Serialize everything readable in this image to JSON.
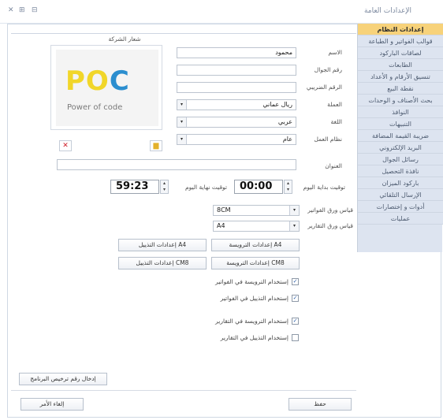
{
  "window": {
    "title": "الإعدادات العامة",
    "controls": [
      "⊟",
      "⊞",
      "⊠"
    ]
  },
  "sidebar": {
    "items": [
      {
        "label": "إعدادات النظام",
        "active": true
      },
      {
        "label": "قوالب الفواتير و الطباعة"
      },
      {
        "label": "لصاقات الباركود"
      },
      {
        "label": "الطابعات"
      },
      {
        "label": "تنسيق الأرقام و الأعداد"
      },
      {
        "label": "نقطة البيع"
      },
      {
        "label": "بحث الأصناف و الوحدات"
      },
      {
        "label": "النوافذ"
      },
      {
        "label": "التنبيهات"
      },
      {
        "label": "ضريبة القيمة المضافة"
      },
      {
        "label": "البريد الإلكتروني"
      },
      {
        "label": "رسائل الجوال"
      },
      {
        "label": "نافذة التحصيل"
      },
      {
        "label": "باركود الميزان"
      },
      {
        "label": "الإرسال التلقائي"
      },
      {
        "label": "أدوات و إختصارات"
      },
      {
        "label": "عمليات"
      }
    ]
  },
  "company_logo": {
    "heading": "شعار الشركة",
    "logo_text": "POC",
    "logo_sub": "Power of code",
    "colors": [
      "#f1d629",
      "#2b8ecf"
    ]
  },
  "fields": {
    "name": {
      "label": "الاسم",
      "value": "محمود"
    },
    "mobile": {
      "label": "رقم الجوال",
      "value": ""
    },
    "tax_number": {
      "label": "الرقم الضريبي",
      "value": ""
    },
    "currency": {
      "label": "العملة",
      "value": "ريال عماني"
    },
    "language": {
      "label": "اللغة",
      "value": "عربي"
    },
    "work_system": {
      "label": "نظام العمل",
      "value": "عام"
    },
    "address": {
      "label": "العنوان",
      "value": ""
    },
    "day_start": {
      "label": "توقيت بداية اليوم",
      "value": "00:00"
    },
    "day_end": {
      "label": "توقيت نهاية اليوم",
      "value": "59:23"
    },
    "invoice_paper": {
      "label": "قياس ورق الفواتير",
      "value": "8CM"
    },
    "report_paper": {
      "label": "قياس ورق التقارير",
      "value": "A4"
    }
  },
  "buttons": {
    "header_a4": "إعدادات الترويسة A4",
    "footer_a4": "إعدادات التذييل A4",
    "header_cm8": "إعدادات الترويسة CM8",
    "footer_cm8": "إعدادات التذييل CM8",
    "license": "إدخال رقم ترخيص البرنامج",
    "save": "حفظ",
    "cancel": "إلغاء الأمر"
  },
  "checks": [
    {
      "label": "إستخدام الترويسة في الفواتير",
      "checked": true
    },
    {
      "label": "إستخدام التذييل في الفواتير",
      "checked": true
    },
    {
      "label": "إستخدام الترويسة في التقارير",
      "checked": true
    },
    {
      "label": "إستخدام التذييل في التقارير",
      "checked": false
    }
  ]
}
